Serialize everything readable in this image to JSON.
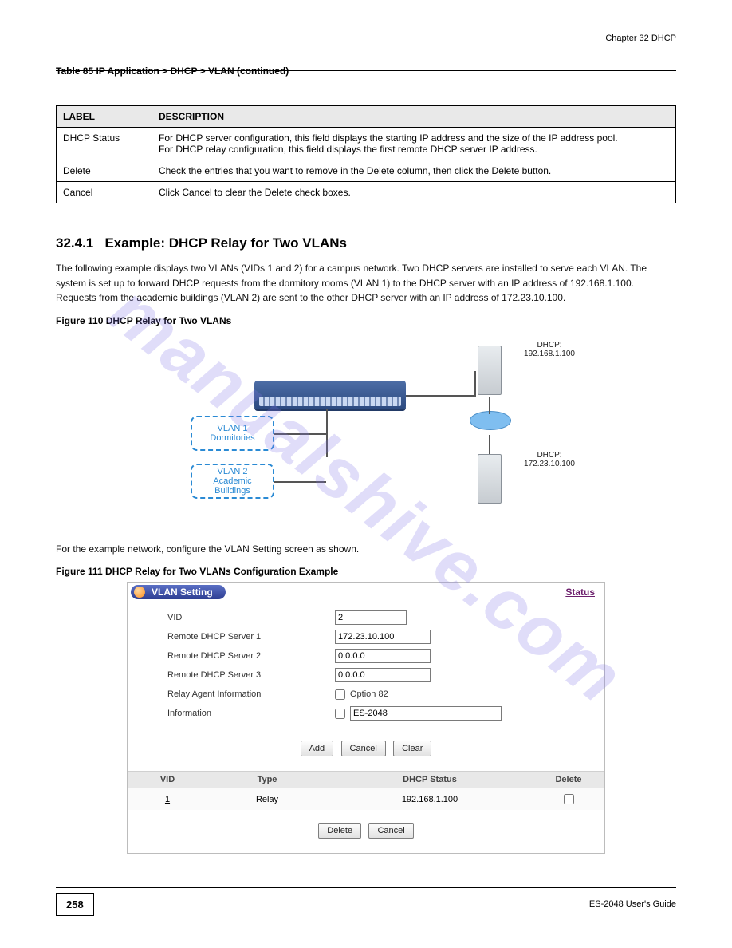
{
  "chapter_header_right": "Chapter 32 DHCP",
  "table_caption": "Table 85   IP Application > DHCP > VLAN (continued)",
  "cols": {
    "label": "LABEL",
    "desc": "DESCRIPTION"
  },
  "rows": [
    {
      "label": "DHCP Status",
      "desc": "For DHCP server configuration, this field displays the starting IP address and the size of the IP address pool.\nFor DHCP relay configuration, this field displays the first remote DHCP server IP address."
    },
    {
      "label": "Delete",
      "desc": "Check the entries that you want to remove in the Delete column, then click the Delete button."
    },
    {
      "label": "Cancel",
      "desc": "Click Cancel to clear the Delete check boxes."
    }
  ],
  "section_no": "32.4.1",
  "section_title": "Example: DHCP Relay for Two VLANs",
  "para1": "The following example displays two VLANs (VIDs 1 and 2) for a campus network. Two DHCP servers are installed to serve each VLAN. The system is set up to forward DHCP requests from the dormitory rooms (VLAN 1) to the DHCP server with an IP address of 192.168.1.100. Requests from the academic buildings (VLAN 2) are sent to the other DHCP server with an IP address of 172.23.10.100.",
  "fig_caption": "Figure 110   DHCP Relay for Two VLANs",
  "diagram": {
    "vlan1": "VLAN 1\nDormitories",
    "vlan2": "VLAN 2\nAcademic\nBuildings",
    "serverA": "DHCP:\n192.168.1.100",
    "serverB": "DHCP:\n172.23.10.100"
  },
  "para2": "For the example network, configure the VLAN Setting screen as shown.",
  "fig2_caption": "Figure 111   DHCP Relay for Two VLANs Configuration Example",
  "panel": {
    "title": "VLAN Setting",
    "status_link": "Status",
    "fields": {
      "vid_label": "VID",
      "vid": "2",
      "s1_label": "Remote DHCP Server 1",
      "s1": "172.23.10.100",
      "s2_label": "Remote DHCP Server 2",
      "s2": "0.0.0.0",
      "s3_label": "Remote DHCP Server 3",
      "s3": "0.0.0.0",
      "relay_label": "Relay Agent Information",
      "relay_opt": "Option 82",
      "info_label": "Information",
      "info_val": "ES-2048"
    },
    "buttons": {
      "add": "Add",
      "cancel": "Cancel",
      "clear": "Clear",
      "delete": "Delete",
      "cancel2": "Cancel"
    },
    "list_headers": {
      "vid": "VID",
      "type": "Type",
      "status": "DHCP Status",
      "del": "Delete"
    },
    "list_rows": [
      {
        "vid": "1",
        "type": "Relay",
        "status": "192.168.1.100"
      }
    ]
  },
  "footer": {
    "page": "258",
    "guide": "ES-2048 User's Guide"
  },
  "watermark": "manualshive.com"
}
